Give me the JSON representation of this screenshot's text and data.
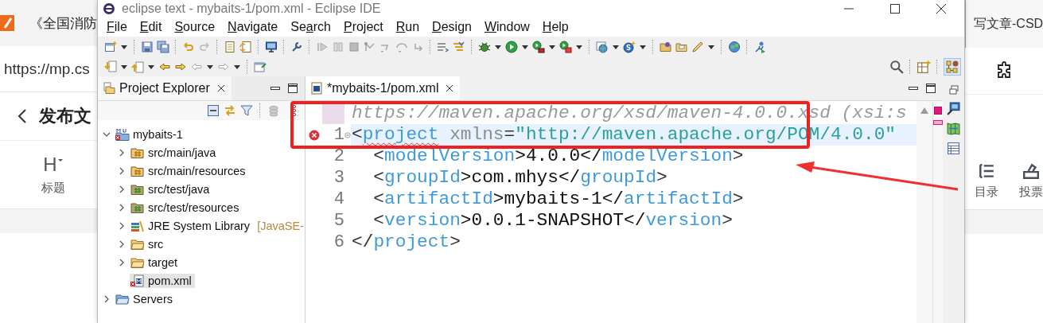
{
  "browser_left": {
    "tab_title": "《全国消防",
    "address": "https://mp.cs",
    "page_title": "发布文",
    "tools": [
      {
        "icon": "H",
        "label": "标题"
      }
    ]
  },
  "eclipse": {
    "title": "eclipse text - mybaits-1/pom.xml - Eclipse IDE",
    "menu": [
      {
        "key": "F",
        "after": "ile"
      },
      {
        "key": "E",
        "after": "dit"
      },
      {
        "key": "S",
        "after": "ource"
      },
      {
        "key": "N",
        "after": "avigate"
      },
      {
        "before": "Se",
        "key": "a",
        "after": "rch"
      },
      {
        "key": "P",
        "after": "roject"
      },
      {
        "key": "R",
        "after": "un"
      },
      {
        "key": "D",
        "after": "esign"
      },
      {
        "key": "W",
        "after": "indow"
      },
      {
        "key": "H",
        "after": "elp"
      }
    ],
    "explorer": {
      "title": "Project Explorer",
      "tree": [
        {
          "label": "mybaits-1",
          "kind": "project",
          "error": true,
          "expanded": true,
          "selected": false,
          "children": [
            {
              "label": "src/main/java",
              "kind": "source",
              "error": false,
              "expanded": false,
              "selected": false
            },
            {
              "label": "src/main/resources",
              "kind": "source",
              "error": false,
              "expanded": false,
              "selected": false
            },
            {
              "label": "src/test/java",
              "kind": "test-source",
              "error": false,
              "expanded": false,
              "selected": false
            },
            {
              "label": "src/test/resources",
              "kind": "test-source",
              "error": false,
              "expanded": false,
              "selected": false
            },
            {
              "label": "JRE System Library",
              "suffix": "[JavaSE-",
              "kind": "library",
              "error": false,
              "expanded": false,
              "selected": false
            },
            {
              "label": "src",
              "kind": "folder",
              "error": false,
              "expanded": false,
              "selected": false
            },
            {
              "label": "target",
              "kind": "folder",
              "error": false,
              "expanded": false,
              "selected": false
            },
            {
              "label": "pom.xml",
              "kind": "file",
              "error": true,
              "selected": true
            }
          ]
        },
        {
          "label": "Servers",
          "kind": "server-folder",
          "error": false,
          "expanded": false,
          "selected": false
        }
      ]
    },
    "editor": {
      "tab": {
        "title": "*mybaits-1/pom.xml",
        "selected": true
      },
      "lines": [
        {
          "error": false,
          "current": false,
          "changed": true,
          "foldable": false,
          "tokens": [
            {
              "t": "https://maven.apache.org/xsd/maven-4.0.0.xsd (xsi:s",
              "kind": "comment"
            }
          ]
        },
        {
          "number": "1",
          "error": true,
          "current": true,
          "changed": false,
          "foldable": true,
          "tokens": [
            {
              "t": "<",
              "kind": "punct"
            },
            {
              "t": "project",
              "kind": "tag"
            },
            {
              "t": " xmlns",
              "kind": "attr"
            },
            {
              "t": "=",
              "kind": "punct"
            },
            {
              "t": "\"http://maven.apache.org/POM/4.0.0\"",
              "kind": "value"
            }
          ]
        },
        {
          "number": "2",
          "error": false,
          "current": false,
          "changed": false,
          "foldable": false,
          "tokens": [
            {
              "t": "  <",
              "kind": "punct"
            },
            {
              "t": "modelVersion",
              "kind": "tag"
            },
            {
              "t": ">4.0.0</",
              "kind": "text"
            },
            {
              "t": "modelVersion",
              "kind": "tag"
            },
            {
              "t": ">",
              "kind": "punct"
            }
          ]
        },
        {
          "number": "3",
          "error": false,
          "current": false,
          "changed": false,
          "foldable": false,
          "tokens": [
            {
              "t": "  <",
              "kind": "punct"
            },
            {
              "t": "groupId",
              "kind": "tag"
            },
            {
              "t": ">com.mhys</",
              "kind": "text"
            },
            {
              "t": "groupId",
              "kind": "tag"
            },
            {
              "t": ">",
              "kind": "punct"
            }
          ]
        },
        {
          "number": "4",
          "error": false,
          "current": false,
          "changed": false,
          "foldable": false,
          "tokens": [
            {
              "t": "  <",
              "kind": "punct"
            },
            {
              "t": "artifactId",
              "kind": "tag"
            },
            {
              "t": ">mybaits-1</",
              "kind": "text"
            },
            {
              "t": "artifactId",
              "kind": "tag"
            },
            {
              "t": ">",
              "kind": "punct"
            }
          ]
        },
        {
          "number": "5",
          "error": false,
          "current": false,
          "changed": false,
          "foldable": false,
          "tokens": [
            {
              "t": "  <",
              "kind": "punct"
            },
            {
              "t": "version",
              "kind": "tag"
            },
            {
              "t": ">0.0.1-SNAPSHOT</",
              "kind": "text"
            },
            {
              "t": "version",
              "kind": "tag"
            },
            {
              "t": ">",
              "kind": "punct"
            }
          ]
        },
        {
          "number": "6",
          "error": false,
          "current": false,
          "changed": false,
          "foldable": false,
          "tokens": [
            {
              "t": "</",
              "kind": "punct"
            },
            {
              "t": "project",
              "kind": "tag"
            },
            {
              "t": ">",
              "kind": "punct"
            }
          ]
        }
      ]
    }
  },
  "browser_right": {
    "tab_title": "写文章-CSD",
    "tools": [
      {
        "label": "目录"
      },
      {
        "label": "投票"
      }
    ]
  }
}
